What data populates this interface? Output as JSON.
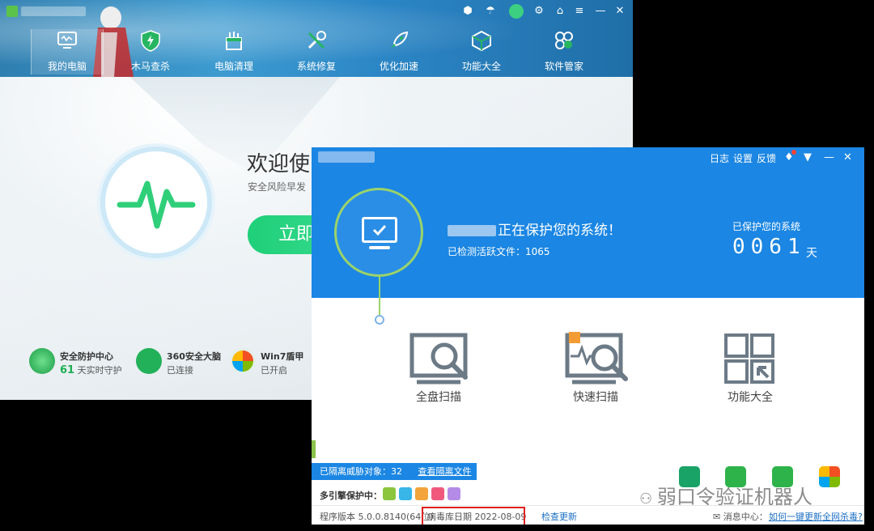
{
  "back_window": {
    "nav": [
      {
        "label": "我的电脑",
        "icon": "monitor-icon"
      },
      {
        "label": "木马查杀",
        "icon": "shield-icon"
      },
      {
        "label": "电脑清理",
        "icon": "broom-icon"
      },
      {
        "label": "系统修复",
        "icon": "wrench-icon"
      },
      {
        "label": "优化加速",
        "icon": "rocket-icon"
      },
      {
        "label": "功能大全",
        "icon": "cube-icon"
      },
      {
        "label": "软件管家",
        "icon": "apps-icon"
      }
    ],
    "welcome_title": "欢迎使",
    "welcome_sub": "安全风险早发",
    "main_button": "立即",
    "features": [
      {
        "title": "安全防护中心",
        "count": "61",
        "sub": "天实时守护"
      },
      {
        "title": "360安全大脑",
        "sub": "已连接"
      },
      {
        "title": "Win7盾甲",
        "sub": "已开启"
      }
    ]
  },
  "front_window": {
    "titlebar_links": [
      "日志",
      "设置",
      "反馈"
    ],
    "protect_text": "正在保护您的系统！",
    "active_files": "已检测活跃文件：1065",
    "protected_label": "已保护您的系统",
    "protected_days": "0061",
    "days_unit": "天",
    "actions": [
      {
        "label": "全盘扫描",
        "icon": "full-scan-icon"
      },
      {
        "label": "快速扫描",
        "icon": "quick-scan-icon"
      },
      {
        "label": "功能大全",
        "icon": "toolbox-icon"
      }
    ],
    "quarantine_text": "已隔离威胁对象：32",
    "quarantine_link": "查看隔离文件",
    "engine_label": "多引擎保护中：",
    "program_version": "程序版本 5.0.0.8140(64位)",
    "virus_db_date": "病毒库日期 2022-08-09",
    "check_update": "检查更新",
    "message_center": "消息中心：",
    "message_link": "如何一键更新全网杀毒?"
  },
  "watermark": "弱口令验证机器人",
  "colors": {
    "blue": "#1b86e3",
    "green": "#1fcf79",
    "red_box": "#e02020"
  }
}
